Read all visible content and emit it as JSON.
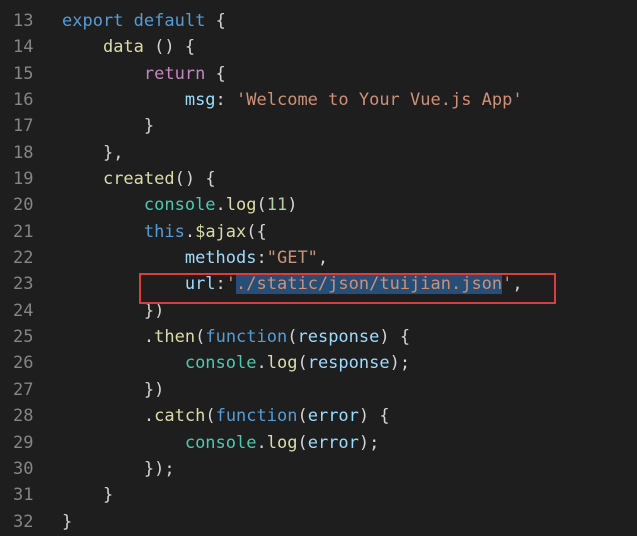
{
  "editor": {
    "lines": [
      {
        "no": "13",
        "tokens": [
          [
            "kw",
            "export"
          ],
          [
            "pl",
            " "
          ],
          [
            "kw",
            "default"
          ],
          [
            "pl",
            " {"
          ]
        ],
        "indent": 0
      },
      {
        "no": "14",
        "tokens": [
          [
            "fn",
            "data"
          ],
          [
            "pl",
            " () {"
          ]
        ],
        "indent": 4
      },
      {
        "no": "15",
        "tokens": [
          [
            "ctl",
            "return"
          ],
          [
            "pl",
            " {"
          ]
        ],
        "indent": 8
      },
      {
        "no": "16",
        "tokens": [
          [
            "var",
            "msg"
          ],
          [
            "pl",
            ": "
          ],
          [
            "str",
            "'Welcome to Your Vue.js App'"
          ]
        ],
        "indent": 12
      },
      {
        "no": "17",
        "tokens": [
          [
            "pl",
            "}"
          ]
        ],
        "indent": 8
      },
      {
        "no": "18",
        "tokens": [
          [
            "pl",
            "},"
          ]
        ],
        "indent": 4
      },
      {
        "no": "19",
        "tokens": [
          [
            "fn",
            "created"
          ],
          [
            "pl",
            "() {"
          ]
        ],
        "indent": 4
      },
      {
        "no": "20",
        "tokens": [
          [
            "cls",
            "console"
          ],
          [
            "pl",
            "."
          ],
          [
            "fn",
            "log"
          ],
          [
            "pl",
            "("
          ],
          [
            "num",
            "11"
          ],
          [
            "pl",
            ")"
          ]
        ],
        "indent": 8
      },
      {
        "no": "21",
        "tokens": [
          [
            "kw",
            "this"
          ],
          [
            "pl",
            "."
          ],
          [
            "fn",
            "$ajax"
          ],
          [
            "pl",
            "({"
          ]
        ],
        "indent": 8
      },
      {
        "no": "22",
        "tokens": [
          [
            "var",
            "methods"
          ],
          [
            "pl",
            ":"
          ],
          [
            "str",
            "\"GET\""
          ],
          [
            "pl",
            ","
          ]
        ],
        "indent": 12
      },
      {
        "no": "23",
        "tokens": [
          [
            "var",
            "url"
          ],
          [
            "pl",
            ":"
          ],
          [
            "str",
            "'"
          ],
          [
            "sel",
            "./static/json/tuijian.json"
          ],
          [
            "str",
            "'"
          ],
          [
            "pl",
            ","
          ]
        ],
        "indent": 12
      },
      {
        "no": "24",
        "tokens": [
          [
            "pl",
            "})"
          ]
        ],
        "indent": 8
      },
      {
        "no": "25",
        "tokens": [
          [
            "pl",
            "."
          ],
          [
            "fn",
            "then"
          ],
          [
            "pl",
            "("
          ],
          [
            "kw",
            "function"
          ],
          [
            "pl",
            "("
          ],
          [
            "var",
            "response"
          ],
          [
            "pl",
            ") {"
          ]
        ],
        "indent": 8
      },
      {
        "no": "26",
        "tokens": [
          [
            "cls",
            "console"
          ],
          [
            "pl",
            "."
          ],
          [
            "fn",
            "log"
          ],
          [
            "pl",
            "("
          ],
          [
            "var",
            "response"
          ],
          [
            "pl",
            ");"
          ]
        ],
        "indent": 12
      },
      {
        "no": "27",
        "tokens": [
          [
            "pl",
            "})"
          ]
        ],
        "indent": 8
      },
      {
        "no": "28",
        "tokens": [
          [
            "pl",
            "."
          ],
          [
            "fn",
            "catch"
          ],
          [
            "pl",
            "("
          ],
          [
            "kw",
            "function"
          ],
          [
            "pl",
            "("
          ],
          [
            "var",
            "error"
          ],
          [
            "pl",
            ") {"
          ]
        ],
        "indent": 8
      },
      {
        "no": "29",
        "tokens": [
          [
            "cls",
            "console"
          ],
          [
            "pl",
            "."
          ],
          [
            "fn",
            "log"
          ],
          [
            "pl",
            "("
          ],
          [
            "var",
            "error"
          ],
          [
            "pl",
            ");"
          ]
        ],
        "indent": 12
      },
      {
        "no": "30",
        "tokens": [
          [
            "pl",
            "});"
          ]
        ],
        "indent": 8
      },
      {
        "no": "31",
        "tokens": [
          [
            "pl",
            "}"
          ]
        ],
        "indent": 4
      },
      {
        "no": "32",
        "tokens": [
          [
            "pl",
            "}"
          ]
        ],
        "indent": 0
      }
    ],
    "selected_text": "./static/json/tuijian.json",
    "highlight_box_color": "#e03b3b"
  }
}
